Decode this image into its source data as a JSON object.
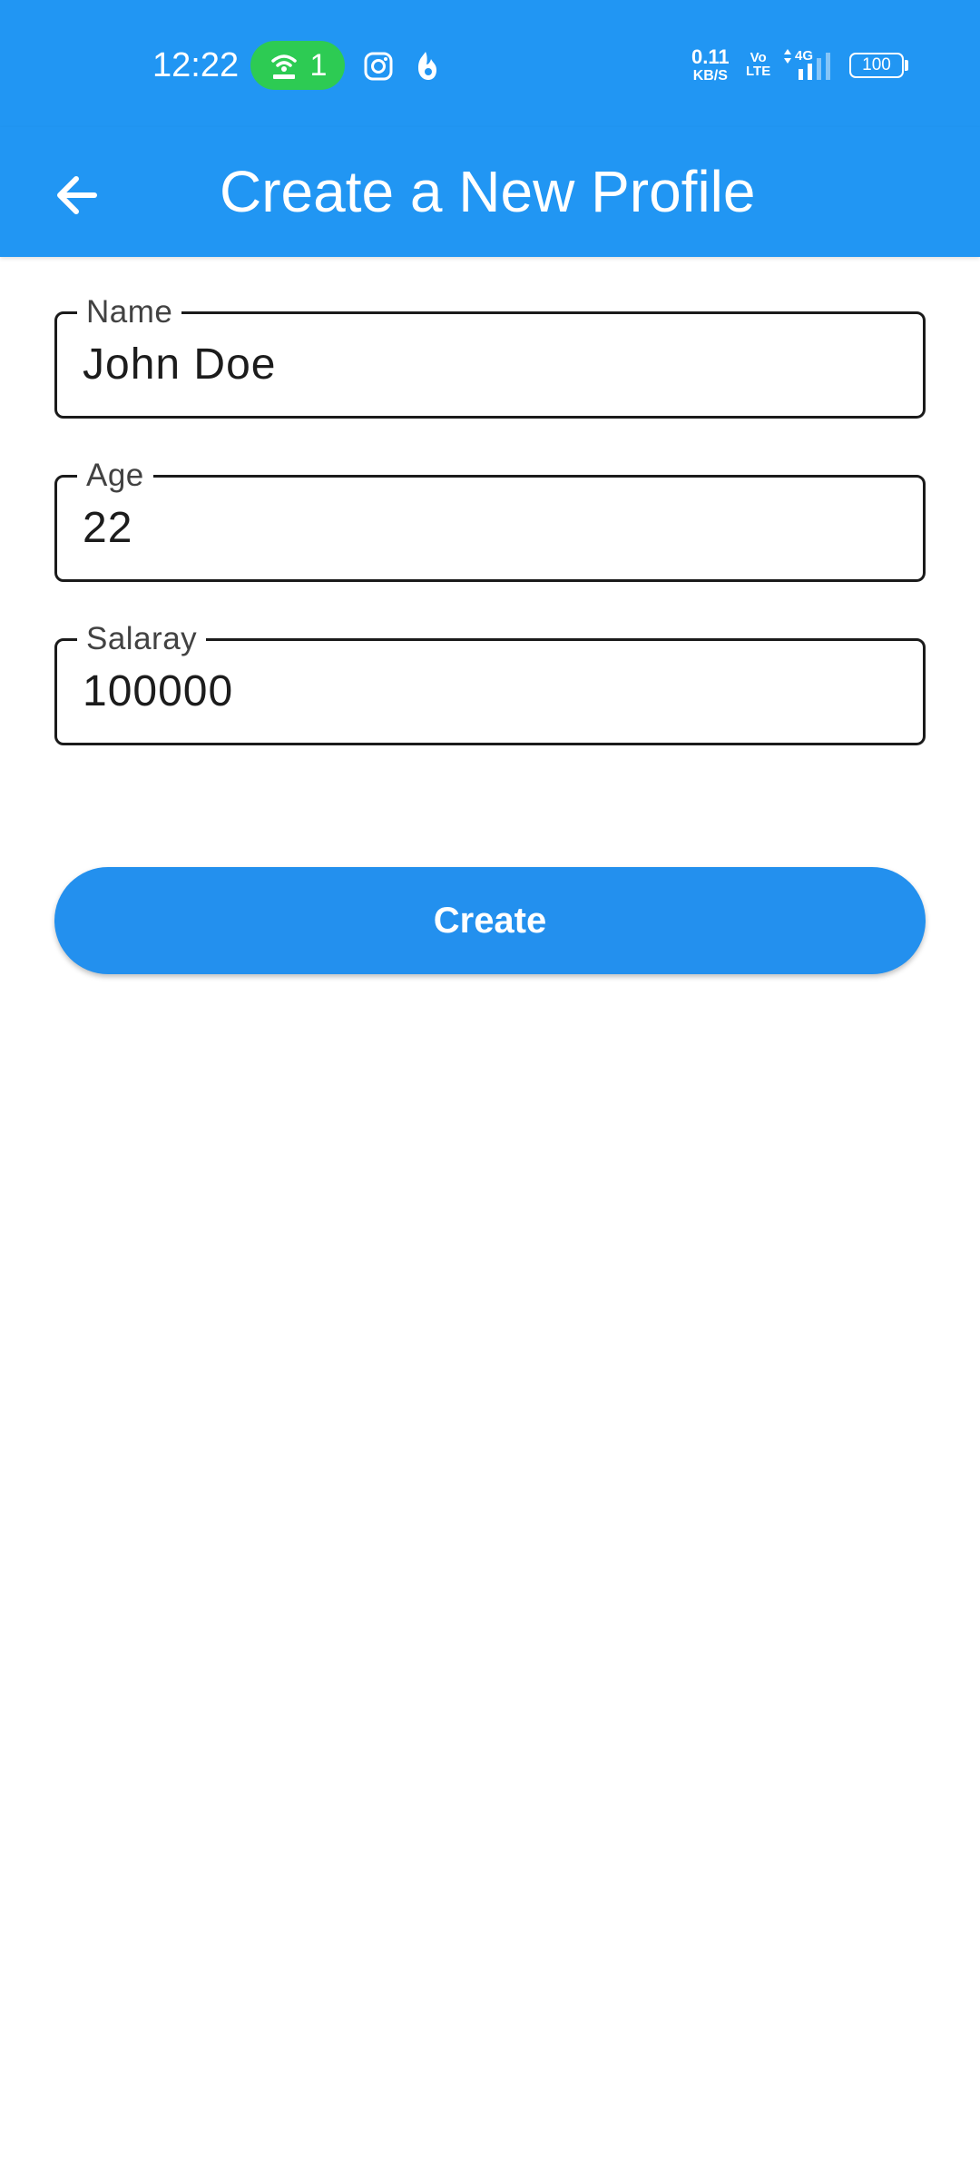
{
  "status_bar": {
    "time": "12:22",
    "hotspot_count": "1",
    "net_speed_value": "0.11",
    "net_speed_unit": "KB/S",
    "volte_top": "Vo",
    "volte_bottom": "LTE",
    "network_type": "4G",
    "battery_level": "100",
    "icons": [
      "hotspot-icon",
      "instagram-icon",
      "app-notification-icon",
      "signal-icon",
      "battery-icon"
    ]
  },
  "app_bar": {
    "title": "Create a New Profile",
    "background_color": "#2196F3"
  },
  "form": {
    "name": {
      "label": "Name",
      "value": "John Doe"
    },
    "age": {
      "label": "Age",
      "value": "22"
    },
    "salary": {
      "label": "Salaray",
      "value": "100000"
    }
  },
  "actions": {
    "create_label": "Create",
    "create_color": "#2390EE"
  }
}
